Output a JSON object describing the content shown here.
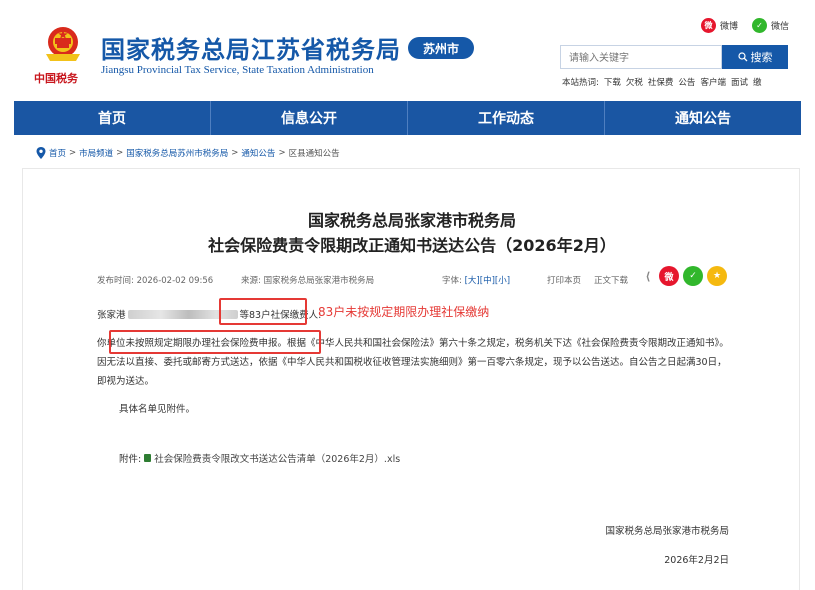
{
  "header": {
    "site_title": "国家税务总局江苏省税务局",
    "site_subtitle": "Jiangsu Provincial Tax Service, State Taxation Administration",
    "brand_signature": "中国税务",
    "city_badge": "苏州市",
    "share": {
      "weibo": "微博",
      "wechat": "微信"
    },
    "search": {
      "placeholder": "请输入关键字",
      "button": "搜索"
    },
    "hot_label": "本站热词:",
    "hot_words": [
      "下载",
      "欠税",
      "社保费",
      "公告",
      "客户端",
      "面试",
      "缴"
    ]
  },
  "nav": {
    "items": [
      "首页",
      "信息公开",
      "工作动态",
      "通知公告"
    ]
  },
  "breadcrumb": {
    "items": [
      "首页",
      "市局频道",
      "国家税务总局苏州市税务局",
      "通知公告",
      "区县通知公告"
    ],
    "separator": ">"
  },
  "article": {
    "title_line1": "国家税务总局张家港市税务局",
    "title_line2": "社会保险费责令限期改正通知书送达公告（2026年2月）",
    "publish_label": "发布时间:",
    "publish_time": "2026-02-02 09:56",
    "source_label": "来源:",
    "source": "国家税务总局张家港市税务局",
    "font_label": "字体:",
    "font_sizes": [
      "大",
      "中",
      "小"
    ],
    "print": "打印本页",
    "download": "正文下载",
    "para1_prefix": "张家港",
    "para1_suffix": "等83户社保缴费人:",
    "annotation": "83户未按规定期限办理社保缴纳",
    "para2": "你单位未按照规定期限办理社会保险费申报。根据《中华人民共和国社会保险法》第六十条之规定，税务机关下达《社会保险费责令限期改正通知书》。因无法以直接、委托或邮寄方式送达，依据《中华人民共和国税收征收管理法实施细则》第一百零六条规定，现予以公告送达。自公告之日起满30日，即视为送达。",
    "para3": "具体名单见附件。",
    "attachment_label": "附件:",
    "attachment_name": "社会保险费责令限改文书送达公告清单（2026年2月）.xls",
    "signature_org": "国家税务总局张家港市税务局",
    "signature_date": "2026年2月2日"
  },
  "colors": {
    "primary_blue": "#1558a8",
    "nav_blue": "#1a56a3",
    "annotation_red": "#e53935"
  }
}
